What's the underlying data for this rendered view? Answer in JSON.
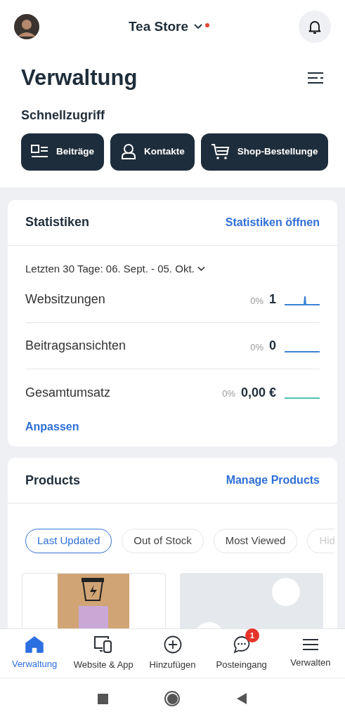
{
  "header": {
    "store_name": "Tea Store",
    "has_notification_dot": true
  },
  "title": "Verwaltung",
  "quick_access": {
    "heading": "Schnellzugriff",
    "items": [
      {
        "label": "Beiträge",
        "kind": "posts"
      },
      {
        "label": "Kontakte",
        "kind": "contacts"
      },
      {
        "label": "Shop-Bestellunge",
        "kind": "cart"
      }
    ]
  },
  "statistics": {
    "title": "Statistiken",
    "link": "Statistiken öffnen",
    "range": "Letzten 30 Tage: 06. Sept. - 05. Okt.",
    "metrics": [
      {
        "label": "Websitzungen",
        "change": "0%",
        "value": "1",
        "kind": "spike",
        "color": "#3b82d6"
      },
      {
        "label": "Beitragsansichten",
        "change": "0%",
        "value": "0",
        "kind": "flat",
        "color": "#3b82d6"
      },
      {
        "label": "Gesamtumsatz",
        "change": "0%",
        "value": "0,00 €",
        "kind": "flat",
        "color": "#4fc3b0"
      }
    ],
    "customize": "Anpassen"
  },
  "products": {
    "title": "Products",
    "link": "Manage Products",
    "filters": [
      {
        "label": "Last Updated",
        "selected": true
      },
      {
        "label": "Out of Stock",
        "selected": false
      },
      {
        "label": "Most Viewed",
        "selected": false
      },
      {
        "label": "Hid",
        "selected": false
      }
    ],
    "items": [
      {
        "kind": "picture"
      },
      {
        "kind": "placeholder"
      }
    ]
  },
  "bottom_nav": [
    {
      "label": "Verwaltung",
      "kind": "home",
      "selected": true
    },
    {
      "label": "Website & App",
      "kind": "devices",
      "selected": false
    },
    {
      "label": "Hinzufügen",
      "kind": "add",
      "selected": false
    },
    {
      "label": "Posteingang",
      "kind": "chat",
      "selected": false,
      "badge": "1"
    },
    {
      "label": "Verwalten",
      "kind": "menu",
      "selected": false
    }
  ]
}
